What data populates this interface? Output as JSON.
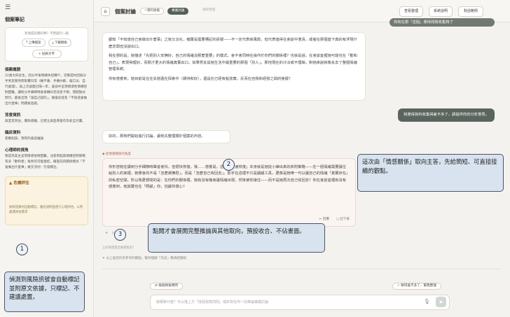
{
  "sidebar": {
    "toggle_glyph": "☰",
    "title": "個案筆記",
    "upload": {
      "question": "有現成的資料嗎？不用進行一趟",
      "upload_label": "⤒ 上傳檔案",
      "download_label": "⤓ 下載模板",
      "add_label": "+ 貼純文字"
    },
    "sections": [
      {
        "heading": "個案概貌",
        "body": "22歲大四女生，因分手後情緒失控轉介，近兩週內因與分手男友衝突而影響日常（睡不著、手機內斂、偏口淡、自行處理）。與上次會面已隔一年，會談中呈現情境性情緒控制困難，讓對分手細節時會昏轉抖音訊息卡頓，而開放式問句，最後出現「滿自己錯的」，總會前提及「不知道會做出什麼事」問題後迴避。"
      },
      {
        "heading": "背景資訊",
        "body": "與室友同住，關係疏離，已建立與直導督作為安全計畫。"
      },
      {
        "heading": "臨床資料",
        "body": "客觀紀錄，現有的會談推論"
      },
      {
        "heading": "心理師的視角",
        "body": "我認為案主呈現情感依附困難，注意到個案情緒控制策略有多「勸和者」角色的可能連結，藉當前的關係模式「不會做出什麼事」做交涉討）引發關注。"
      }
    ],
    "alert": {
      "heading": "▲ 危機評估",
      "item": "依對話素材自動標記，優先說明並進行心理評估，以利處遇評估需求"
    }
  },
  "topbar": {
    "home_glyph": "⌂",
    "title": "個案討論",
    "steps": [
      "✓資料收集",
      "專業討論",
      "總結整理"
    ],
    "buttons": [
      "查看整理",
      "系統說明",
      "對話範例"
    ]
  },
  "chat": {
    "ai_bubble_1": [
      "鄙知「不知道自己會做出什麼事」之後又淡化，確實是需要標記的訊號——不一定代表高風險，但代表值得在會談中澄清，或者在那個當下真的有浮現什麼念頭但沒說出口。",
      "我在想的是，她描述「先把別人安撫好，自己的情緒沒那麼重要」的模式，會不會同時在操作於你們的關係裡？也就是說，在會談室裡她可能也在「勸和自己」，表現得理好，而剛才更大的情緒真實出口。如果男友是她生活中最重要的那個「別人」，那他現在的冷淡或不理睬，對她來說就像失去了整個情緒管理系統。",
      "你有感覺到，她目前是在往失戀還在探索中（期待和好），還是在已經有點放棄，反而在自我和經營之間的搖擺？"
    ],
    "user_bubble_1": "你有在想「這個」覺得問題收集夠了",
    "user_bubble_2": "我覺得資料收集得差不多了，請提供你的分析意見。",
    "ai_bubble_2": "好的，那我們開始進行討論，讓我先整理關於個案的內容。",
    "case_label": "◆ 從情感關係的角度",
    "case_text": "你形容她在講到分手細節時聲音會抖，但很快恢復，我……感覺是，這個「快速恢復」本身就是她從小練出來的依附策略——在一個情緒需要讓位給別人的家裡，她學會的不是「怎麼被撫慰」，而是「怎麼自己收回去」。影手在這裡不只是讓顧工具，更像是她唯一可以讓自己的情緒「真實存在」的私密空間。所以我更想問的是：在你們的關係裡，她有沒有機會讓情緒出現，然後被你接住——而不是她再次自己收回去？你在會談室裡有沒有感覺到，她其實也在「照顧」你，怕讓你擔心？",
    "case_actions": [
      "↔ 回覆",
      "◻ 記下來"
    ],
    "mini_add": "+",
    "mini_ctrl": "◇",
    "hint": "立即展開還是繼續推進？",
    "rec": "✦ 以上會話作為參考的觀點，幫你理解「先前」暢清結關係"
  },
  "bottom": {
    "chip_left": "⇄ 換個視角問問",
    "chip_right": "✓ 聊得差不多了，幫我整理",
    "input_placeholder": "接著聊什麼？可以描上方「換個視角問問」或針對任何一段推論繼續討論",
    "mic_glyph": "🎙",
    "send_glyph": "➤"
  },
  "annotations": {
    "one": {
      "num": "1",
      "text": "偵測到風險訊號會自動標記並附原文依據，只標記、不建議處置。"
    },
    "two": {
      "num": "2",
      "text": "這次由「情感關係」取向主答，先給簡短、可直接接續的觀點。"
    },
    "three": {
      "num": "3",
      "text": "點開才會展開完整推論與其他取向，預設收合、不佔畫面。"
    }
  }
}
